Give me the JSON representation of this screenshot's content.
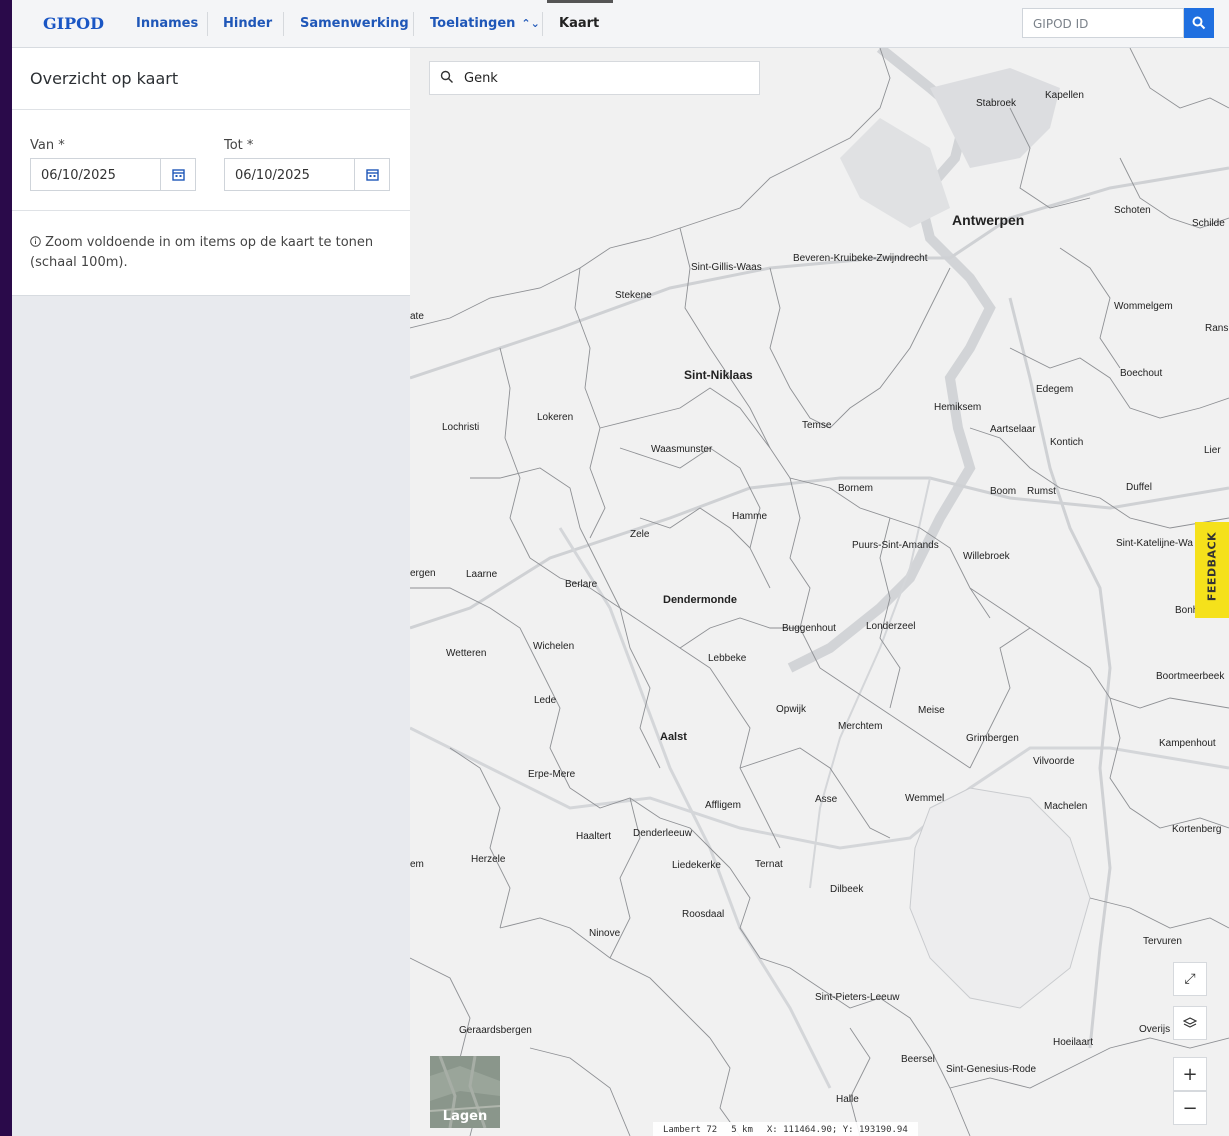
{
  "brand": "GIPOD",
  "nav": [
    {
      "label": "Innames"
    },
    {
      "label": "Hinder"
    },
    {
      "label": "Samenwerking"
    },
    {
      "label": "Toelatingen"
    },
    {
      "label": "Kaart"
    }
  ],
  "search_id": {
    "placeholder": "GIPOD ID"
  },
  "panel": {
    "title": "Overzicht op kaart",
    "from_label": "Van *",
    "from_value": "06/10/2025",
    "to_label": "Tot *",
    "to_value": "06/10/2025",
    "info_line1": "Zoom voldoende in om items op de kaart te tonen",
    "info_line2": "(schaal 100m)."
  },
  "map": {
    "search_value": "Genk",
    "feedback_label": "FEEDBACK",
    "layers_label": "Lagen",
    "zoom_in": "+",
    "zoom_out": "−",
    "projection": "Lambert 72",
    "scale": "5 km",
    "coords": "X: 111464.90; Y: 193190.94",
    "places": [
      "Antwerpen",
      "Stabroek",
      "Kapellen",
      "Schoten",
      "Schilde",
      "Beveren-Kruibeke-Zwijndrecht",
      "Sint-Gillis-Waas",
      "Stekene",
      "Wommelgem",
      "Rans",
      "Sint-Niklaas",
      "Boechout",
      "Edegem",
      "Hemiksem",
      "Aartselaar",
      "Kontich",
      "Lokeren",
      "Lochristi",
      "Temse",
      "Waasmunster",
      "Lier",
      "Bornem",
      "Boom",
      "Rumst",
      "Duffel",
      "Hamme",
      "Zele",
      "Puurs-Sint-Amands",
      "Willebroek",
      "Sint-Katelijne-Wa",
      "Laarne",
      "Berlare",
      "Dendermonde",
      "Buggenhout",
      "Londerzeel",
      "Bonh",
      "Wetteren",
      "Wichelen",
      "Lebbeke",
      "Boortmeerbeek",
      "Lede",
      "Opwijk",
      "Meise",
      "Merchtem",
      "Aalst",
      "Grimbergen",
      "Kampenhout",
      "Vilvoorde",
      "Erpe-Mere",
      "Affligem",
      "Asse",
      "Wemmel",
      "Machelen",
      "Kortenberg",
      "Haaltert",
      "Denderleeuw",
      "Herzele",
      "Liedekerke",
      "Ternat",
      "Dilbeek",
      "Roosdaal",
      "Ninove",
      "Tervuren",
      "Sint-Pieters-Leeuw",
      "Geraardsbergen",
      "Overijs",
      "Hoeilaart",
      "Beersel",
      "Sint-Genesius-Rode",
      "Halle",
      "ate",
      "ergen",
      "em"
    ],
    "accent": "#1f6fe0",
    "feedback_color": "#f5e11b"
  }
}
